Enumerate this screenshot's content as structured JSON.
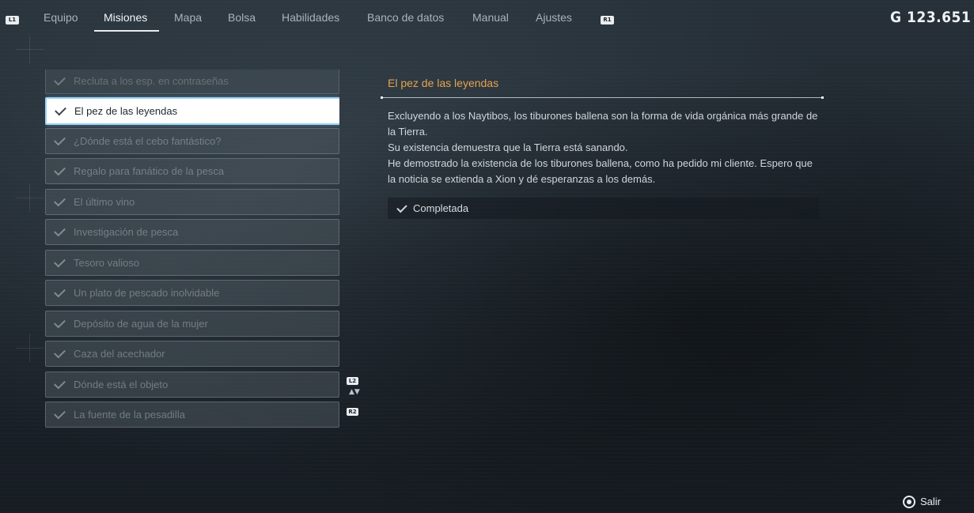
{
  "topbar": {
    "left_bumper": "L1",
    "right_bumper": "R1",
    "tabs": [
      {
        "label": "Equipo"
      },
      {
        "label": "Misiones"
      },
      {
        "label": "Mapa"
      },
      {
        "label": "Bolsa"
      },
      {
        "label": "Habilidades"
      },
      {
        "label": "Banco de datos"
      },
      {
        "label": "Manual"
      },
      {
        "label": "Ajustes"
      }
    ],
    "active_tab": "Misiones",
    "gold": "G  123.651"
  },
  "quests": [
    {
      "label": "Recluta a los esp. en contraseñas",
      "completed": true
    },
    {
      "label": "El pez de las leyendas",
      "completed": true
    },
    {
      "label": "¿Dónde está el cebo fantástico?",
      "completed": true
    },
    {
      "label": "Regalo para fanático de la pesca",
      "completed": true
    },
    {
      "label": "El último vino",
      "completed": true
    },
    {
      "label": "Investigación de pesca",
      "completed": true
    },
    {
      "label": "Tesoro valioso",
      "completed": true
    },
    {
      "label": "Un plato de pescado inolvidable",
      "completed": true
    },
    {
      "label": "Depósito de agua de la mujer",
      "completed": true
    },
    {
      "label": "Caza del acechador",
      "completed": true
    },
    {
      "label": "Dónde está el objeto",
      "completed": true
    },
    {
      "label": "La fuente de la pesadilla",
      "completed": true
    }
  ],
  "selected_quest": "El pez de las leyendas",
  "scroll": {
    "up_tag": "L2",
    "down_tag": "R2",
    "arrows": "▲▼"
  },
  "detail": {
    "title": "El pez de las leyendas",
    "paragraphs": [
      "Excluyendo a los Naytibos, los tiburones ballena son la forma de vida orgánica más grande de la Tierra.",
      "Su existencia demuestra que la Tierra está sanando.",
      "He demostrado la existencia de los tiburones ballena, como ha pedido mi cliente. Espero que la noticia se extienda a Xion y dé esperanzas a los demás."
    ],
    "status": "Completada"
  },
  "footer": {
    "exit_label": "Salir"
  },
  "colors": {
    "accent_title": "#e7a24e",
    "selection_border": "#9dd3f6"
  }
}
